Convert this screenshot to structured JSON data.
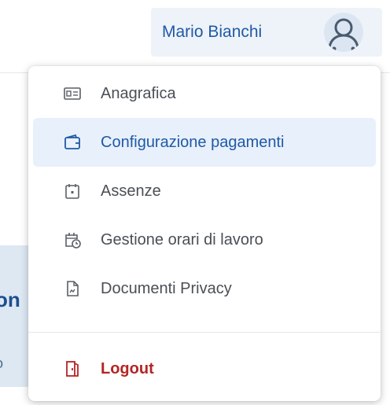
{
  "header": {
    "user_name": "Mario Bianchi",
    "avatar_icon": "user-avatar-icon"
  },
  "background": {
    "fragment_title": "on",
    "fragment_sub": "o"
  },
  "menu": {
    "items": [
      {
        "label": "Anagrafica",
        "icon": "id-card-icon",
        "active": false
      },
      {
        "label": "Configurazione pagamenti",
        "icon": "wallet-icon",
        "active": true
      },
      {
        "label": "Assenze",
        "icon": "calendar-icon",
        "active": false
      },
      {
        "label": "Gestione orari di lavoro",
        "icon": "calendar-clock-icon",
        "active": false
      },
      {
        "label": "Documenti Privacy",
        "icon": "document-icon",
        "active": false
      }
    ],
    "logout": {
      "label": "Logout",
      "icon": "logout-door-icon"
    }
  },
  "colors": {
    "accent": "#1f5aa6",
    "active_bg": "#e8f0fb",
    "logout": "#b32525",
    "text": "#4a4f56"
  }
}
